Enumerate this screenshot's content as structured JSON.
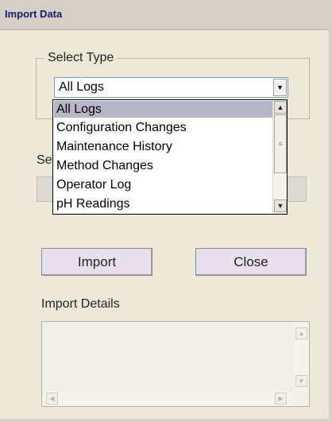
{
  "window": {
    "title": "Import Data"
  },
  "select_type": {
    "label": "Select Type",
    "selected_value": "All Logs",
    "options": [
      "All Logs",
      "Configuration Changes",
      "Maintenance History",
      "Method Changes",
      "Operator Log",
      "pH Readings"
    ]
  },
  "partial_label": "Se",
  "buttons": {
    "import_label": "Import",
    "close_label": "Close"
  },
  "details": {
    "label": "Import Details"
  },
  "icons": {
    "combo": "chevron-down-icon",
    "list_up": "arrow-up-icon",
    "list_down": "arrow-down-icon",
    "scroll_grip": "grip-icon"
  },
  "colors": {
    "window_bg": "#ece9d8",
    "title_text": "#1a1a6c",
    "button_bg": "#e8e0ec",
    "selected_item_bg": "#b6b6c8"
  }
}
